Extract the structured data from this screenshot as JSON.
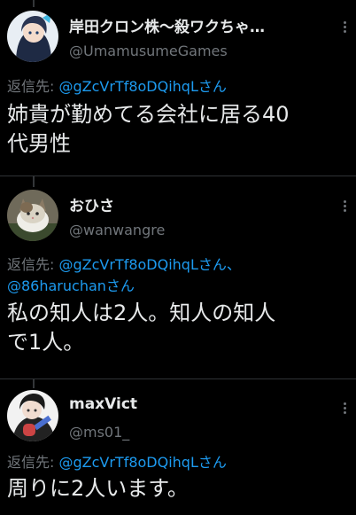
{
  "tweets": [
    {
      "name": "岸田クロン株〜殺ワクちゃ…",
      "handle": "@UmamusumeGames",
      "reply_prefix": "返信先: ",
      "mentions": [
        "@gZcVrTf8oDQihqLさん"
      ],
      "reply_lines": [
        [
          "@gZcVrTf8oDQihqLさん"
        ]
      ],
      "body": "姉貴が勤めてる会社に居る40代男性",
      "avatar": "anime-character-avatar"
    },
    {
      "name": "おひさ",
      "handle": "@wanwangre",
      "reply_prefix": "返信先: ",
      "reply_line1_mention": "@gZcVrTf8oDQihqLさん、",
      "reply_line2_mention": "@86haruchanさん",
      "body": "私の知人は2人。知人の知人で1人。",
      "avatar": "cat-photo-avatar"
    },
    {
      "name": "maxVict",
      "handle": "@ms01_",
      "reply_prefix": "返信先: ",
      "reply_line1_mention": "@gZcVrTf8oDQihqLさん",
      "body": "周りに2人います。",
      "avatar": "anime-guitarist-avatar"
    }
  ],
  "t1": {
    "name": "岸田クロン株〜殺ワクちゃ…",
    "handle": "@UmamusumeGames",
    "reply_prefix": "返信先: ",
    "mention1": "@gZcVrTf8oDQihqLさん",
    "body_line1": "姉貴が勤めてる会社に居る40",
    "body_line2": "代男性"
  },
  "t2": {
    "name": "おひさ",
    "handle": "@wanwangre",
    "reply_prefix": "返信先: ",
    "mention1": "@gZcVrTf8oDQihqLさん、",
    "mention2": "@86haruchanさん",
    "body_line1": "私の知人は2人。知人の知人",
    "body_line2": "で1人。"
  },
  "t3": {
    "name": "maxVict",
    "handle": "@ms01_",
    "reply_prefix": "返信先: ",
    "mention1": "@gZcVrTf8oDQihqLさん",
    "body_line1": "周りに2人います。"
  },
  "colors": {
    "background": "#000000",
    "text": "#e7e9ea",
    "secondary": "#71767b",
    "link": "#1d9bf0",
    "divider": "#2f3336"
  },
  "icons": [
    "more-options-icon"
  ]
}
